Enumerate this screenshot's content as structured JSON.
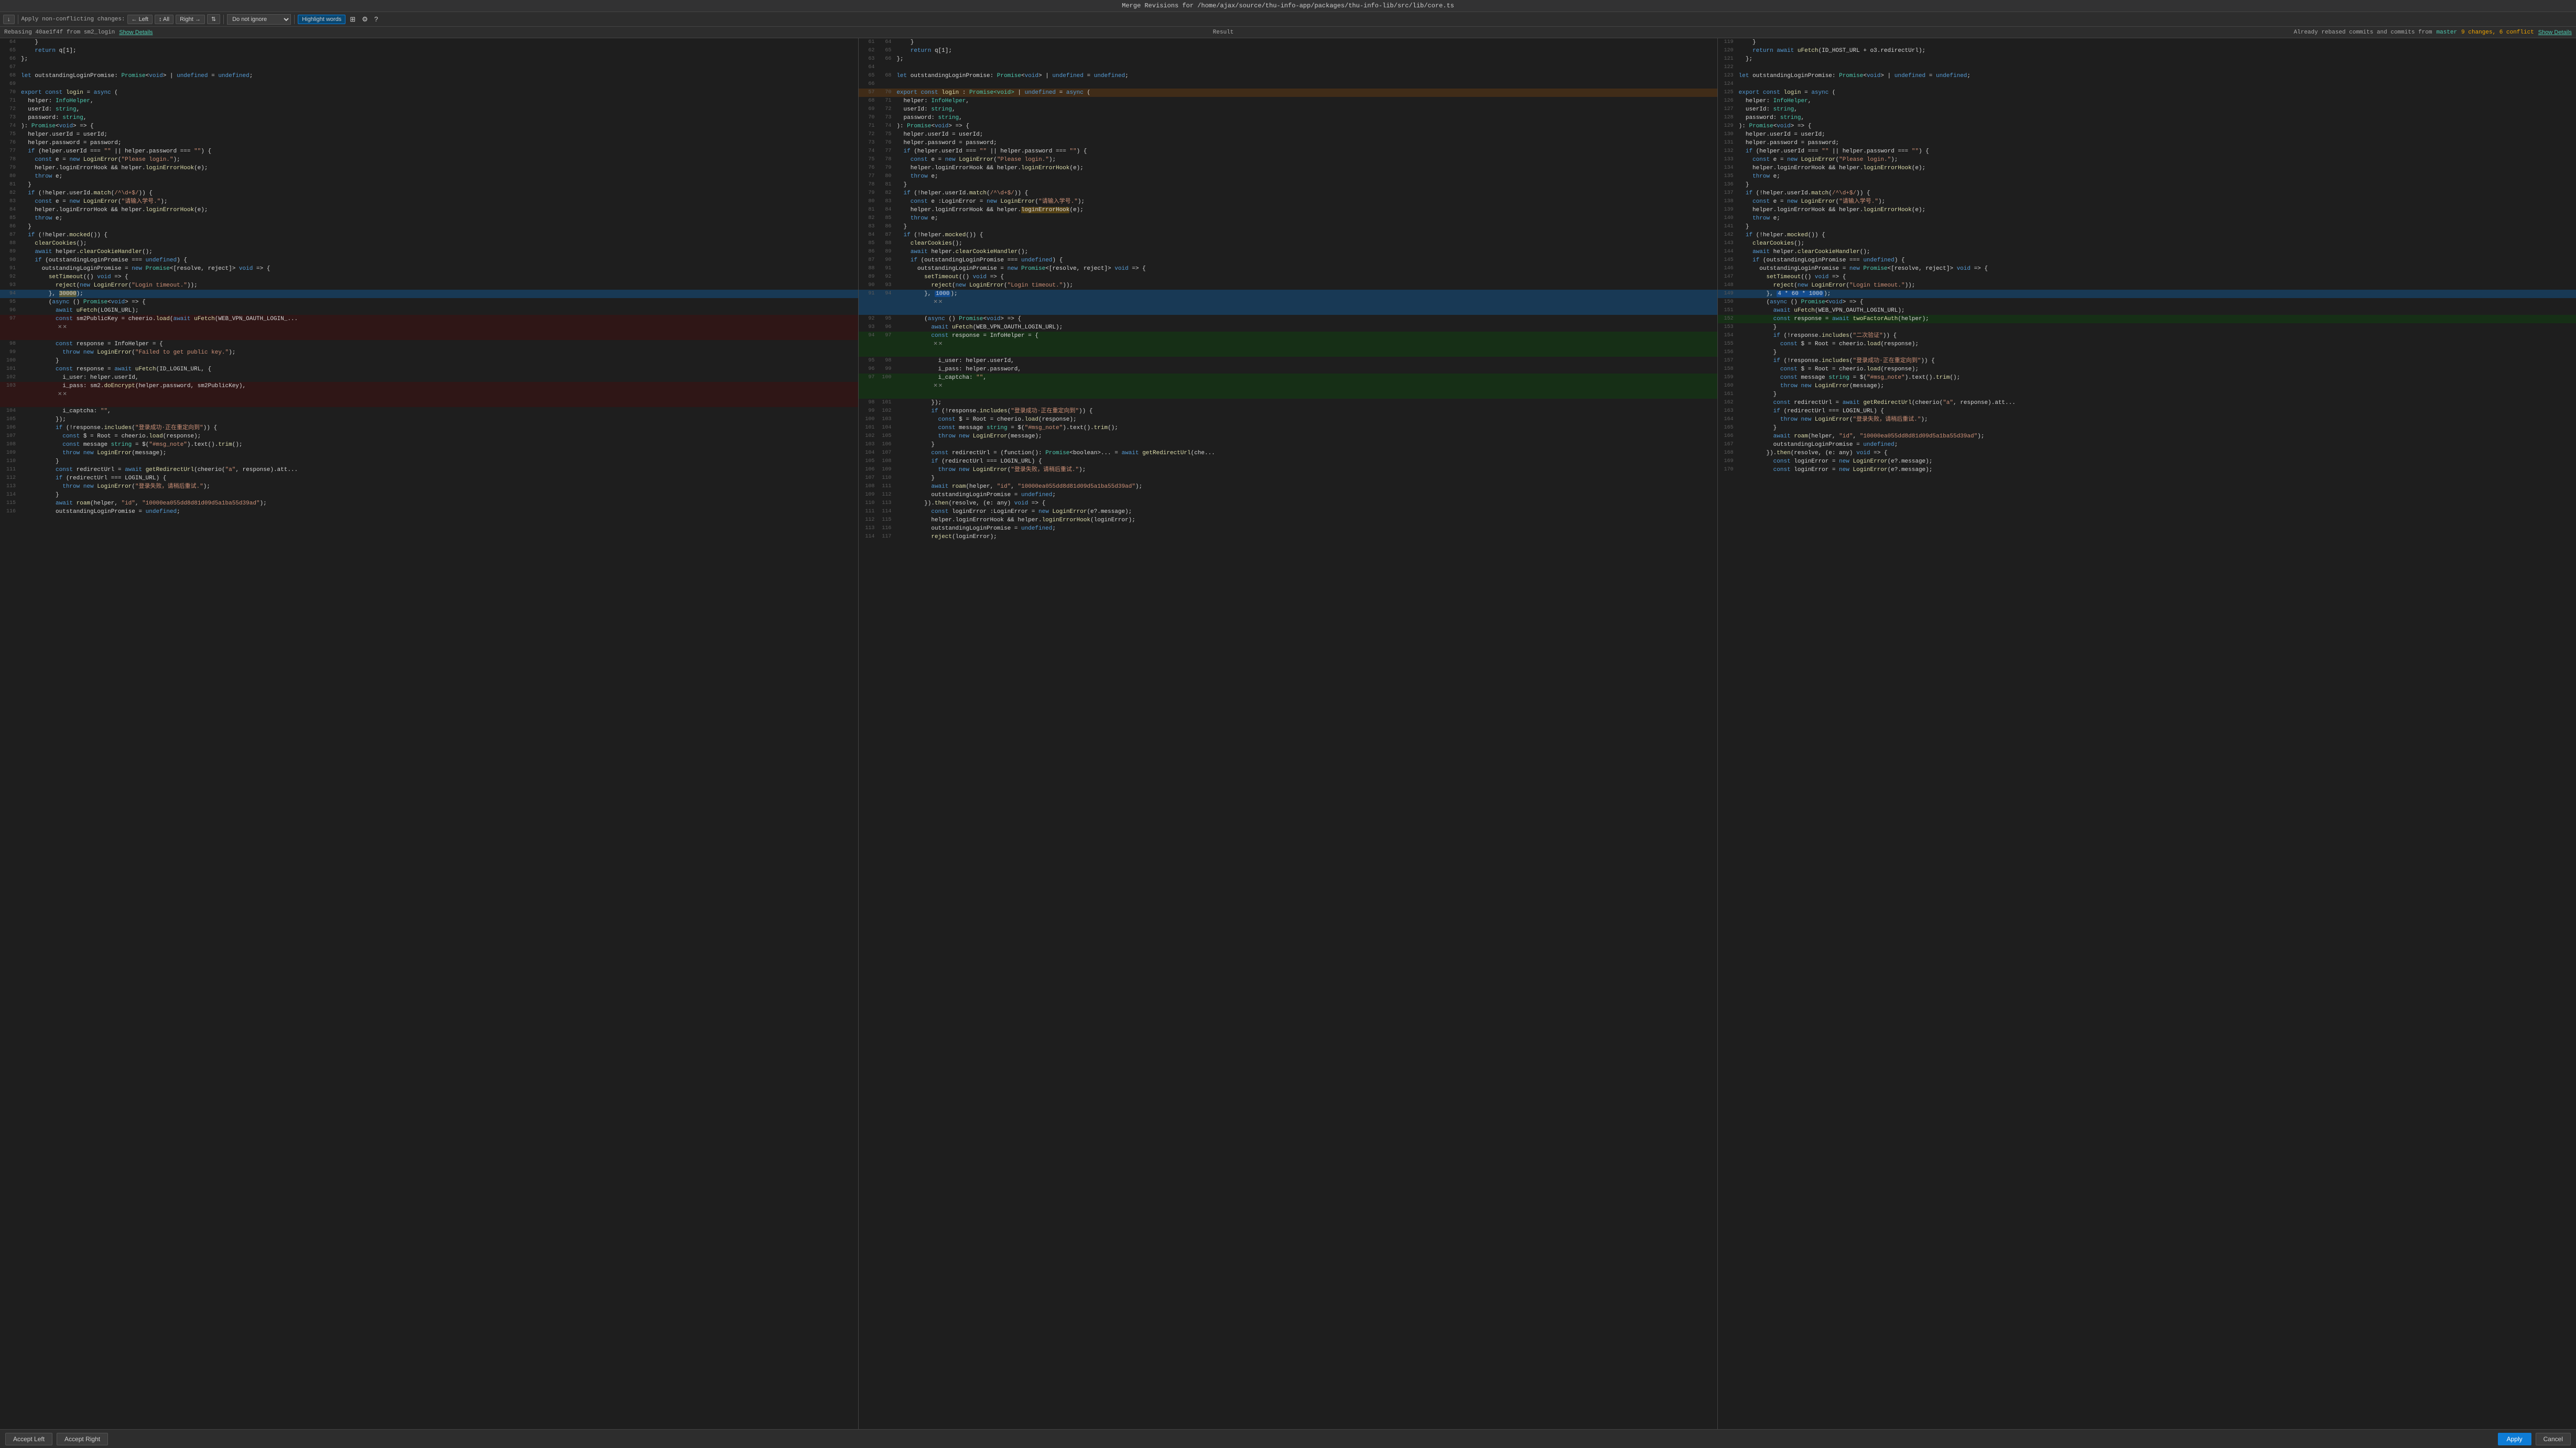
{
  "title": "Merge Revisions for /home/ajax/source/thu-info-app/packages/thu-info-lib/src/lib/core.ts",
  "toolbar": {
    "download_label": "↓",
    "apply_changes_label": "Apply non-conflicting changes:",
    "left_label": "← Left",
    "all_label": "↕ All",
    "right_label": "Right →",
    "sort_label": "⇅",
    "ignore_label": "Do not ignore",
    "highlight_label": "Highlight words",
    "settings_icon": "⚙",
    "help_icon": "?",
    "layout_icon": "⊞"
  },
  "status": {
    "rebasing": "Rebasing 40ae1f4f from sm2_login",
    "show_details": "Show Details",
    "result_label": "Result",
    "changes_label": "9 changes, 6 conflict",
    "already_rebased": "Already rebased commits and commits from",
    "master_label": "master",
    "show_details_right": "Show Details"
  },
  "panes": {
    "left_nums": [
      64,
      65,
      66,
      67,
      68,
      69,
      70,
      71,
      72,
      73,
      74,
      75,
      76,
      77,
      78,
      79,
      80,
      81,
      82,
      83,
      84,
      85,
      86,
      87,
      88,
      89,
      90,
      91,
      92,
      93,
      94,
      95,
      96,
      97,
      98,
      99,
      100,
      101,
      102,
      103,
      104,
      105,
      106,
      107,
      108,
      109,
      110,
      111,
      112,
      113,
      114,
      115,
      116
    ],
    "right_nums": [
      121,
      122,
      123,
      124,
      125,
      126,
      127,
      128,
      129,
      130,
      131,
      132,
      133,
      134,
      135,
      136,
      137,
      138,
      139,
      140,
      141,
      142,
      143,
      144,
      145,
      146,
      147,
      148,
      149,
      150,
      151,
      152,
      153,
      154,
      155,
      156,
      157,
      158,
      159,
      160,
      161,
      162,
      163,
      164,
      165,
      166,
      167,
      168,
      169,
      170
    ]
  },
  "bottom": {
    "accept_left": "Accept Left",
    "accept_right": "Accept Right",
    "apply": "Apply",
    "cancel": "Cancel"
  }
}
